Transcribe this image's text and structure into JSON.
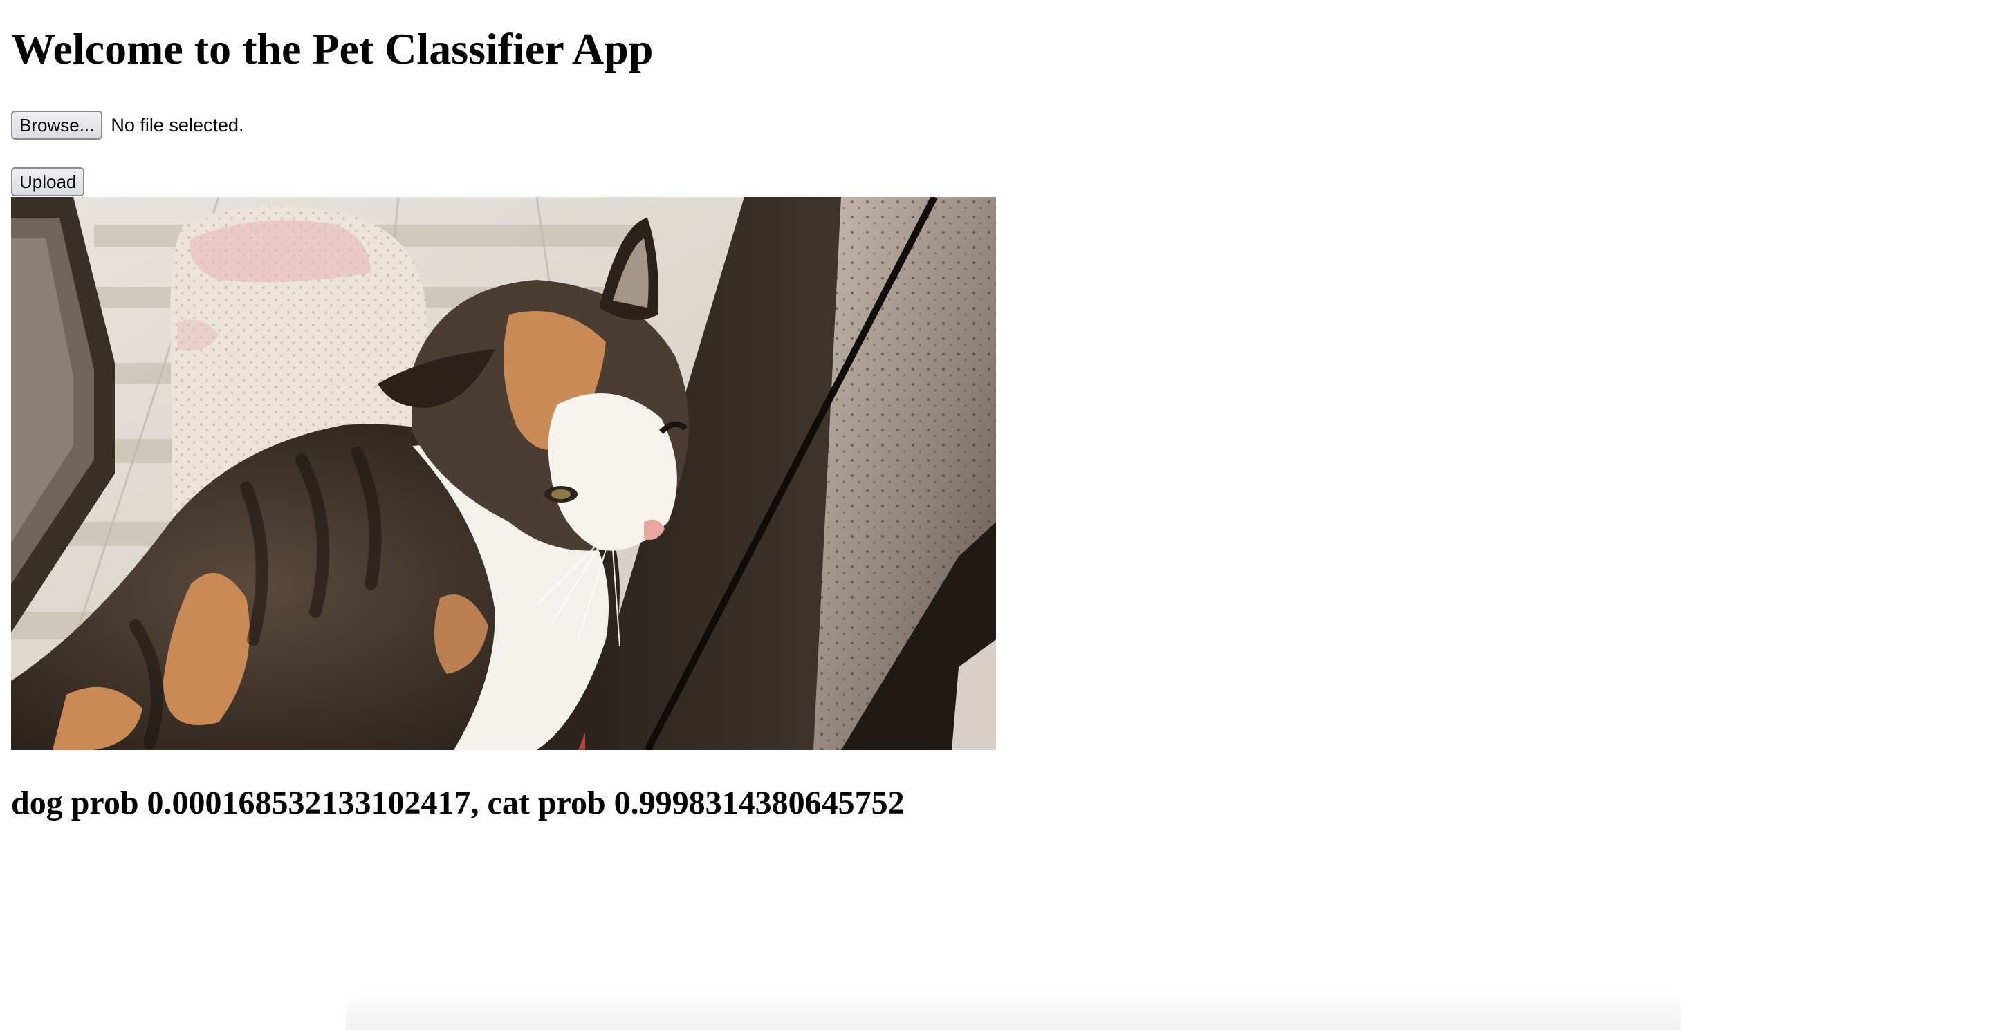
{
  "page": {
    "title": "Welcome to the Pet Classifier App",
    "result_text": "dog prob 0.000168532133102417, cat prob 0.9998314380645752"
  },
  "file_input": {
    "browse_label": "Browse...",
    "status": "No file selected."
  },
  "form": {
    "upload_label": "Upload"
  },
  "prediction": {
    "dog_prob": 0.000168532133102417,
    "cat_prob": 0.9998314380645752
  }
}
